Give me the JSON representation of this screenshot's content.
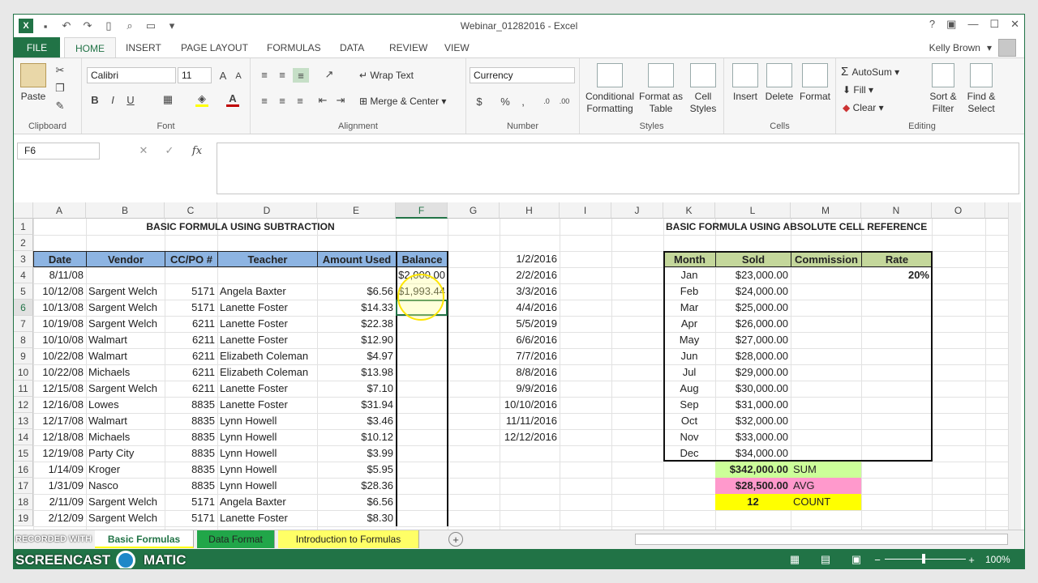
{
  "window": {
    "title": "Webinar_01282016 - Excel",
    "user": "Kelly Brown"
  },
  "tabs": [
    "FILE",
    "HOME",
    "INSERT",
    "PAGE LAYOUT",
    "FORMULAS",
    "DATA",
    "REVIEW",
    "VIEW"
  ],
  "ribbon": {
    "clipboard": {
      "label": "Clipboard",
      "paste": "Paste"
    },
    "font": {
      "label": "Font",
      "name": "Calibri",
      "size": "11"
    },
    "alignment": {
      "label": "Alignment",
      "wrap": "Wrap Text",
      "merge": "Merge & Center"
    },
    "number": {
      "label": "Number",
      "format": "Currency"
    },
    "styles": {
      "label": "Styles",
      "cond1": "Conditional",
      "cond2": "Formatting",
      "fmt1": "Format as",
      "fmt2": "Table",
      "cs1": "Cell",
      "cs2": "Styles"
    },
    "cells": {
      "label": "Cells",
      "insert": "Insert",
      "delete": "Delete",
      "format": "Format"
    },
    "editing": {
      "label": "Editing",
      "autosum": "AutoSum",
      "fill": "Fill",
      "clear": "Clear",
      "sort1": "Sort &",
      "sort2": "Filter",
      "find1": "Find &",
      "find2": "Select"
    }
  },
  "namebox": "F6",
  "columns": [
    "A",
    "B",
    "C",
    "D",
    "E",
    "F",
    "G",
    "H",
    "I",
    "J",
    "K",
    "L",
    "M",
    "N",
    "O",
    "P"
  ],
  "rows": [
    "1",
    "2",
    "3",
    "4",
    "5",
    "6",
    "7",
    "8",
    "9",
    "10",
    "11",
    "12",
    "13",
    "14",
    "15",
    "16",
    "17",
    "18",
    "19"
  ],
  "left": {
    "title": "BASIC FORMULA USING SUBTRACTION",
    "headers": [
      "Date",
      "Vendor",
      "CC/PO #",
      "Teacher",
      "Amount Used",
      "Balance"
    ],
    "data": [
      [
        "8/11/08",
        "",
        "",
        "",
        "",
        "$2,000.00"
      ],
      [
        "10/12/08",
        "Sargent Welch",
        "5171",
        "Angela Baxter",
        "$6.56",
        "$1,993.44"
      ],
      [
        "10/13/08",
        "Sargent Welch",
        "5171",
        "Lanette Foster",
        "$14.33",
        ""
      ],
      [
        "10/19/08",
        "Sargent Welch",
        "6211",
        "Lanette Foster",
        "$22.38",
        ""
      ],
      [
        "10/10/08",
        "Walmart",
        "6211",
        "Lanette Foster",
        "$12.90",
        ""
      ],
      [
        "10/22/08",
        "Walmart",
        "6211",
        "Elizabeth Coleman",
        "$4.97",
        ""
      ],
      [
        "10/22/08",
        "Michaels",
        "6211",
        "Elizabeth Coleman",
        "$13.98",
        ""
      ],
      [
        "12/15/08",
        "Sargent Welch",
        "6211",
        "Lanette Foster",
        "$7.10",
        ""
      ],
      [
        "12/16/08",
        "Lowes",
        "8835",
        "Lanette Foster",
        "$31.94",
        ""
      ],
      [
        "12/17/08",
        "Walmart",
        "8835",
        "Lynn Howell",
        "$3.46",
        ""
      ],
      [
        "12/18/08",
        "Michaels",
        "8835",
        "Lynn Howell",
        "$10.12",
        ""
      ],
      [
        "12/19/08",
        "Party City",
        "8835",
        "Lynn Howell",
        "$3.99",
        ""
      ],
      [
        "1/14/09",
        "Kroger",
        "8835",
        "Lynn Howell",
        "$5.95",
        ""
      ],
      [
        "1/31/09",
        "Nasco",
        "8835",
        "Lynn Howell",
        "$28.36",
        ""
      ],
      [
        "2/11/09",
        "Sargent Welch",
        "5171",
        "Angela Baxter",
        "$6.56",
        ""
      ],
      [
        "2/12/09",
        "Sargent Welch",
        "5171",
        "Lanette Foster",
        "$8.30",
        ""
      ]
    ]
  },
  "dates": [
    "1/2/2016",
    "2/2/2016",
    "3/3/2016",
    "4/4/2016",
    "5/5/2019",
    "6/6/2016",
    "7/7/2016",
    "8/8/2016",
    "9/9/2016",
    "10/10/2016",
    "11/11/2016",
    "12/12/2016"
  ],
  "right": {
    "title": "BASIC FORMULA USING ABSOLUTE CELL REFERENCE",
    "headers": [
      "Month",
      "Sold",
      "Commission",
      "Rate"
    ],
    "rate": "20%",
    "months": [
      [
        "Jan",
        "$23,000.00"
      ],
      [
        "Feb",
        "$24,000.00"
      ],
      [
        "Mar",
        "$25,000.00"
      ],
      [
        "Apr",
        "$26,000.00"
      ],
      [
        "May",
        "$27,000.00"
      ],
      [
        "Jun",
        "$28,000.00"
      ],
      [
        "Jul",
        "$29,000.00"
      ],
      [
        "Aug",
        "$30,000.00"
      ],
      [
        "Sep",
        "$31,000.00"
      ],
      [
        "Oct",
        "$32,000.00"
      ],
      [
        "Nov",
        "$33,000.00"
      ],
      [
        "Dec",
        "$34,000.00"
      ]
    ],
    "sum": "$342,000.00",
    "sum_label": "SUM",
    "avg": "$28,500.00",
    "avg_label": "AVG",
    "count": "12",
    "count_label": "COUNT"
  },
  "sheets": [
    "Basic Formulas",
    "Data Format",
    "Introduction to Formulas"
  ],
  "zoom": "100%",
  "watermark": {
    "line1": "RECORDED WITH",
    "line2": "SCREENCAST",
    "line3": "MATIC"
  },
  "colors": {
    "excel_green": "#217346",
    "header_blue": "#8db4e2",
    "header_green": "#c4d79b",
    "sum_green": "#ccff99",
    "avg_pink": "#ff99cc",
    "count_yellow": "#ffff00"
  }
}
